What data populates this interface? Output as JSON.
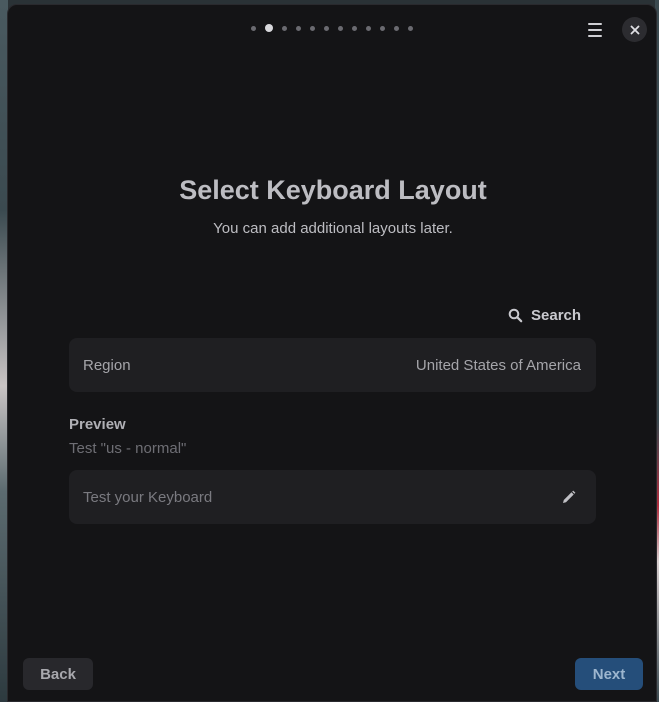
{
  "window": {
    "title": "Select Keyboard Layout",
    "subtitle": "You can add additional layouts later.",
    "progress": {
      "total": 12,
      "current": 2
    }
  },
  "header": {
    "menu_icon": "hamburger-menu-icon",
    "close_icon": "close-icon"
  },
  "search": {
    "label": "Search",
    "icon": "search-icon"
  },
  "region": {
    "label": "Region",
    "value": "United States of America"
  },
  "preview": {
    "heading": "Preview",
    "subtitle": "Test \"us - normal\"",
    "placeholder": "Test your Keyboard",
    "edit_icon": "pencil-icon"
  },
  "footer": {
    "back_label": "Back",
    "next_label": "Next"
  },
  "colors": {
    "accent": "#254e7a",
    "background": "#141416",
    "card": "#1f1f22"
  }
}
